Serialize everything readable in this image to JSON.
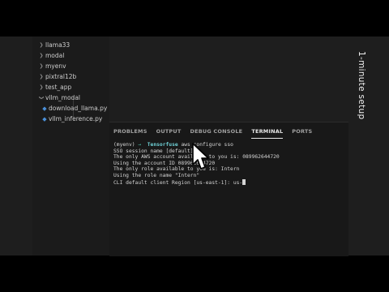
{
  "explorer": {
    "items": [
      {
        "label": "llama33",
        "type": "folder",
        "icon": "chevron-right-icon"
      },
      {
        "label": "modal",
        "type": "folder",
        "icon": "chevron-right-icon"
      },
      {
        "label": "myenv",
        "type": "folder",
        "icon": "chevron-right-icon"
      },
      {
        "label": "pixtral12b",
        "type": "folder",
        "icon": "chevron-right-icon"
      },
      {
        "label": "test_app",
        "type": "folder",
        "icon": "chevron-right-icon"
      },
      {
        "label": "vllm_modal",
        "type": "folder-open",
        "icon": "chevron-down-icon"
      },
      {
        "label": "download_llama.py",
        "type": "file",
        "icon": "python-file-icon"
      },
      {
        "label": "vllm_inference.py",
        "type": "file",
        "icon": "python-file-icon"
      }
    ]
  },
  "panel": {
    "tabs": [
      {
        "label": "PROBLEMS",
        "active": false
      },
      {
        "label": "OUTPUT",
        "active": false
      },
      {
        "label": "DEBUG CONSOLE",
        "active": false
      },
      {
        "label": "TERMINAL",
        "active": true
      },
      {
        "label": "PORTS",
        "active": false
      }
    ]
  },
  "terminal": {
    "env": "(myenv)",
    "arrow": "→",
    "dir": "Tensorfuse",
    "command": "aws configure sso",
    "lines": [
      "SSO session name [default]:",
      "The only AWS account available to you is: 089962644720",
      "Using the account ID 089962644720",
      "The only role available to you is: Intern",
      "Using the role name \"Intern\"",
      "CLI default client Region [us-east-1]: us-"
    ]
  },
  "overlay": {
    "title": "1-minute setup"
  }
}
